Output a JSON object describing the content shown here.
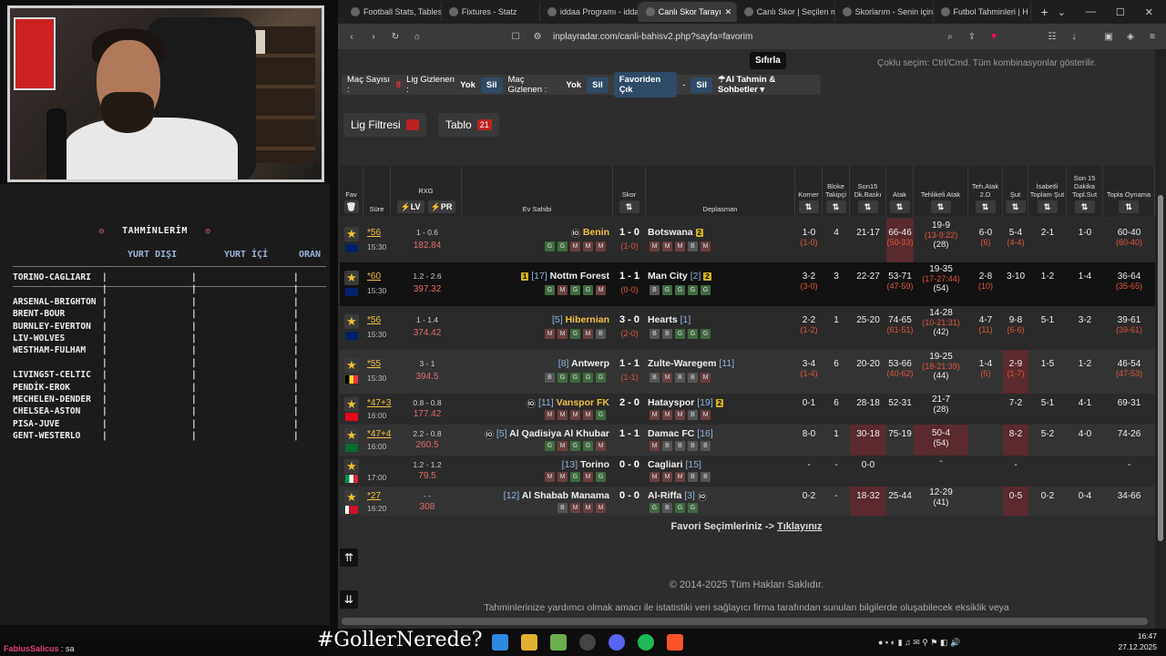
{
  "overlay": {
    "tahmin_title": "TAHMİNLERİM",
    "col_yurt_disi": "YURT DIŞI",
    "col_yurt_ici": "YURT İÇİ",
    "col_oran": "ORAN",
    "matches": [
      "TORINO-CAGLIARI",
      "",
      "ARSENAL-BRIGHTON",
      "BRENT-BOUR",
      "BURNLEY-EVERTON",
      "LIV-WOLVES",
      "WESTHAM-FULHAM",
      "",
      "LIVINGST-CELTIC",
      "PENDİK-EROK",
      "MECHELEN-DENDER",
      "CHELSEA-ASTON",
      "PISA-JUVE",
      "GENT-WESTERLO"
    ],
    "chat_user": "FabiusSalicus",
    "chat_msg": " : sa",
    "hashtag": "#GollerNerede?"
  },
  "browser": {
    "tabs": [
      "Football Stats, Tables",
      "Fixtures - Statz",
      "iddaa Programı - idda",
      "Canlı Skor Tarayı",
      "Canlı Skor | Seçilen m",
      "Skorlarım - Senin için",
      "Futbol Tahminleri | H"
    ],
    "active_tab": 3,
    "url": "inplayradar.com/canli-bahisv2.php?sayfa=favorim"
  },
  "page": {
    "sifirla": "Sıfırla",
    "coklu": "Çoklu seçim: Ctrl/Cmd. Tüm kombinasyonlar gösterilir.",
    "mac_sayisi": "Maç Sayısı :",
    "mac_count": "8",
    "lig_gizlenen": "Lig Gizlenen :",
    "lig_yok": "Yok",
    "sil": "Sil",
    "mac_gizlenen": "Maç Gizlenen :",
    "mac_yok": "Yok",
    "favoriden_cik": "Favoriden Çık",
    "ai_tahmin": "AI Tahmin & Sohbetler",
    "lig_filtresi": "Lig Filtresi",
    "tablo": "Tablo",
    "tablo_count": "21",
    "favori": "Favori Seçimleriniz -> ",
    "tiklayiniz": "Tıklayınız",
    "copyright": "© 2014-2025 Tüm Hakları Saklıdır.",
    "disclaimer": "Tahminlerinize yardımcı olmak amacı ile istatistiki veri sağlayıcı firma tarafından sunulan bilgilerde oluşabilecek eksiklik veya"
  },
  "headers": {
    "fav": "Fav",
    "sure": "Süre",
    "rxg": "RXG",
    "lv": "LV",
    "pr": "PR",
    "ev": "Ev Sahibi",
    "skor": "Skor",
    "dep": "Deplasman",
    "korner": "Korner",
    "bloke": "Bloke Takipçi",
    "son15": "Son15 Dk.Baskı",
    "atak": "Atak",
    "tehlikeli": "Tehlikeli Atak",
    "teh2d": "Teh.Atak 2.D",
    "sut": "Şut",
    "isabetli": "İsabetli Toplam Şut",
    "son15sut": "Son 15 Dakika Topl.Sut",
    "topla": "Topla Oynama"
  },
  "rows": [
    {
      "min": "*56",
      "time": "15:30",
      "flag": "gb",
      "rxg1": "1 - 0.6",
      "rxg2": "182.84",
      "home": "Benin",
      "home_rank": "",
      "home_pre": "io",
      "home_color": "#f0c040",
      "home_form": "GGMMM",
      "score": "1 - 0",
      "half": "(1-0)",
      "away": "Botswana",
      "away_rank": "",
      "away_badge": "2",
      "away_form": "MMMBM",
      "korner": "1-0",
      "korner2": "(1-0)",
      "bloke": "4",
      "son15": "21-17",
      "atak": "66-46",
      "atak2": "(50-33)",
      "teh": "19-9",
      "teh2": "(13-9:22)",
      "teh3": "(28)",
      "t2d": "6-0",
      "t2d2": "(6)",
      "sut": "5-4",
      "sut2": "(4-4)",
      "isabet": "2-1",
      "s15": "1-0",
      "topla": "60-40",
      "topla2": "(60-40)",
      "bg": "#2a2a2a"
    },
    {
      "min": "*60",
      "time": "15:30",
      "flag": "gb",
      "rxg1": "1.2 - 2.6",
      "rxg2": "397.32",
      "home": "Nottm Forest",
      "home_rank": "[17]",
      "home_pre": "1",
      "home_color": "#eee",
      "home_form": "GMGGM",
      "score": "1 - 1",
      "half": "(0-0)",
      "away": "Man City",
      "away_rank": "[2]",
      "away_badge": "2",
      "away_form": "BGGGG",
      "korner": "3-2",
      "korner2": "(3-0)",
      "bloke": "3",
      "son15": "22-27",
      "atak": "53-71",
      "atak2": "(47-59)",
      "teh": "19-35",
      "teh2": "(17-27:44)",
      "teh3": "(54)",
      "t2d": "2-8",
      "t2d2": "(10)",
      "sut": "3-10",
      "sut2": "",
      "isabet": "1-2",
      "s15": "1-4",
      "topla": "36-64",
      "topla2": "(35-65)",
      "bg": "#111"
    },
    {
      "min": "*56",
      "time": "15:30",
      "flag": "gb",
      "rxg1": "1 - 1.4",
      "rxg2": "374.42",
      "home": "Hibernian",
      "home_rank": "[5]",
      "home_pre": "",
      "home_color": "#f0c040",
      "home_form": "MMGMB",
      "score": "3 - 0",
      "half": "(2-0)",
      "away": "Hearts",
      "away_rank": "[1]",
      "away_badge": "",
      "away_form": "BBGGG",
      "korner": "2-2",
      "korner2": "(1-2)",
      "bloke": "1",
      "son15": "25-20",
      "atak": "74-65",
      "atak2": "(61-51)",
      "teh": "14-28",
      "teh2": "(10-21:31)",
      "teh3": "(42)",
      "t2d": "4-7",
      "t2d2": "(11)",
      "sut": "9-8",
      "sut2": "(6-6)",
      "isabet": "5-1",
      "s15": "3-2",
      "topla": "39-61",
      "topla2": "(39-61)",
      "bg": "#2a2a2a"
    },
    {
      "min": "*55",
      "time": "15:30",
      "flag": "be",
      "rxg1": "3 - 1",
      "rxg2": "394.5",
      "home": "Antwerp",
      "home_rank": "[8]",
      "home_pre": "",
      "home_color": "#eee",
      "home_form": "BGGGG",
      "score": "1 - 1",
      "half": "(1-1)",
      "away": "Zulte-Waregem",
      "away_rank": "[11]",
      "away_badge": "",
      "away_form": "BMBBM",
      "korner": "3-4",
      "korner2": "(1-4)",
      "bloke": "6",
      "son15": "20-20",
      "atak": "53-66",
      "atak2": "(40-62)",
      "teh": "19-25",
      "teh2": "(18-21:39)",
      "teh3": "(44)",
      "t2d": "1-4",
      "t2d2": "(5)",
      "sut": "2-9",
      "sut2": "(1-7)",
      "isabet": "1-5",
      "s15": "1-2",
      "topla": "46-54",
      "topla2": "(47-53)",
      "bg": "#333"
    },
    {
      "min": "*47+3",
      "time": "16:00",
      "flag": "tr",
      "rxg1": "0.8 - 0.8",
      "rxg2": "177.42",
      "home": "Vanspor FK",
      "home_rank": "[11]",
      "home_pre": "io",
      "home_color": "#f0c040",
      "home_form": "MMMMG",
      "score": "2 - 0",
      "half": "",
      "away": "Hatayspor",
      "away_rank": "[19]",
      "away_badge": "2",
      "away_form": "MMMBM",
      "korner": "0-1",
      "korner2": "",
      "bloke": "6",
      "son15": "28-18",
      "atak": "52-31",
      "atak2": "",
      "teh": "21-7",
      "teh2": "",
      "teh3": "(28)",
      "t2d": "",
      "t2d2": "",
      "sut": "7-2",
      "sut2": "",
      "isabet": "5-1",
      "s15": "4-1",
      "topla": "69-31",
      "topla2": "",
      "bg": "#2a2a2a"
    },
    {
      "min": "*47+4",
      "time": "16:00",
      "flag": "sa",
      "rxg1": "2.2 - 0.8",
      "rxg2": "260.5",
      "home": "Al Qadisiya Al Khubar",
      "home_rank": "[5]",
      "home_pre": "io",
      "home_color": "#eee",
      "home_form": "GMGGM",
      "score": "1 - 1",
      "half": "",
      "away": "Damac FC",
      "away_rank": "[16]",
      "away_badge": "",
      "away_form": "MBBBB",
      "korner": "8-0",
      "korner2": "",
      "bloke": "1",
      "son15": "30-18",
      "atak": "75-19",
      "atak2": "",
      "teh": "50-4",
      "teh2": "",
      "teh3": "(54)",
      "t2d": "",
      "t2d2": "",
      "sut": "8-2",
      "sut2": "",
      "isabet": "5-2",
      "s15": "4-0",
      "topla": "74-26",
      "topla2": "",
      "bg": "#333"
    },
    {
      "min": "",
      "time": "17:00",
      "flag": "it",
      "rxg1": "1.2 - 1.2",
      "rxg2": "79.5",
      "home": "Torino",
      "home_rank": "[13]",
      "home_pre": "",
      "home_color": "#eee",
      "home_form": "MMGMG",
      "score": "0 - 0",
      "half": "",
      "away": "Cagliari",
      "away_rank": "[15]",
      "away_badge": "",
      "away_form": "MMMBB",
      "korner": "-",
      "korner2": "",
      "bloke": "-",
      "son15": "0-0",
      "atak": "",
      "atak2": "",
      "teh": "-",
      "teh2": "",
      "teh3": "",
      "t2d": "",
      "t2d2": "",
      "sut": "-",
      "sut2": "",
      "isabet": "",
      "s15": "",
      "topla": "-",
      "topla2": "",
      "bg": "#2a2a2a"
    },
    {
      "min": "*27",
      "time": "16:20",
      "flag": "bh",
      "rxg1": "- -",
      "rxg2": "308",
      "home": "Al Shabab Manama",
      "home_rank": "[12]",
      "home_pre": "",
      "home_color": "#eee",
      "home_form": "BMMM",
      "score": "0 - 0",
      "half": "",
      "away": "Al-Riffa",
      "away_rank": "[3]",
      "away_badge": "io",
      "away_form": "GBGG",
      "korner": "0-2",
      "korner2": "",
      "bloke": "-",
      "son15": "18-32",
      "atak": "25-44",
      "atak2": "",
      "teh": "12-29",
      "teh2": "",
      "teh3": "(41)",
      "t2d": "",
      "t2d2": "",
      "sut": "0-5",
      "sut2": "",
      "isabet": "0-2",
      "s15": "0-4",
      "topla": "34-66",
      "topla2": "",
      "bg": "#333"
    }
  ],
  "clock": {
    "time": "16:47",
    "date": "27.12.2025"
  }
}
